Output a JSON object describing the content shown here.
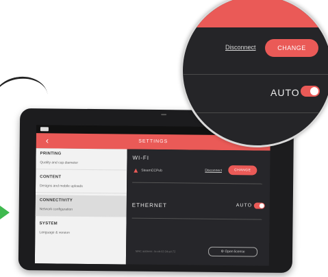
{
  "header": {
    "title": "SETTINGS",
    "back_icon": "chevron-left-icon",
    "back_glyph": "‹"
  },
  "sidebar": {
    "items": [
      {
        "label": "PRINTING",
        "sub": "Quality and cup diameter"
      },
      {
        "label": "CONTENT",
        "sub": "Designs and mobile uploads"
      },
      {
        "label": "CONNECTIVITY",
        "sub": "Network configuration"
      },
      {
        "label": "SYSTEM",
        "sub": "Language & version"
      }
    ],
    "active_index": 2
  },
  "wifi": {
    "heading": "WI-FI",
    "icon": "wifi-icon",
    "ssid": "SteamCCPub",
    "disconnect": "Disconnect",
    "change": "CHANGE"
  },
  "ethernet": {
    "heading": "ETHERNET",
    "mode": "AUTO",
    "toggle_on": true
  },
  "footer": {
    "mac": "MAC address: 4c:cb:02:2d:a4:72",
    "license_icon": "gear-icon",
    "license": "Open license"
  },
  "magnifier": {
    "disconnect": "Disconnect",
    "change": "CHANGE",
    "auto": "AUTO"
  },
  "colors": {
    "accent": "#ea5a57",
    "panel": "#26262a",
    "arrow": "#3fb94f"
  }
}
